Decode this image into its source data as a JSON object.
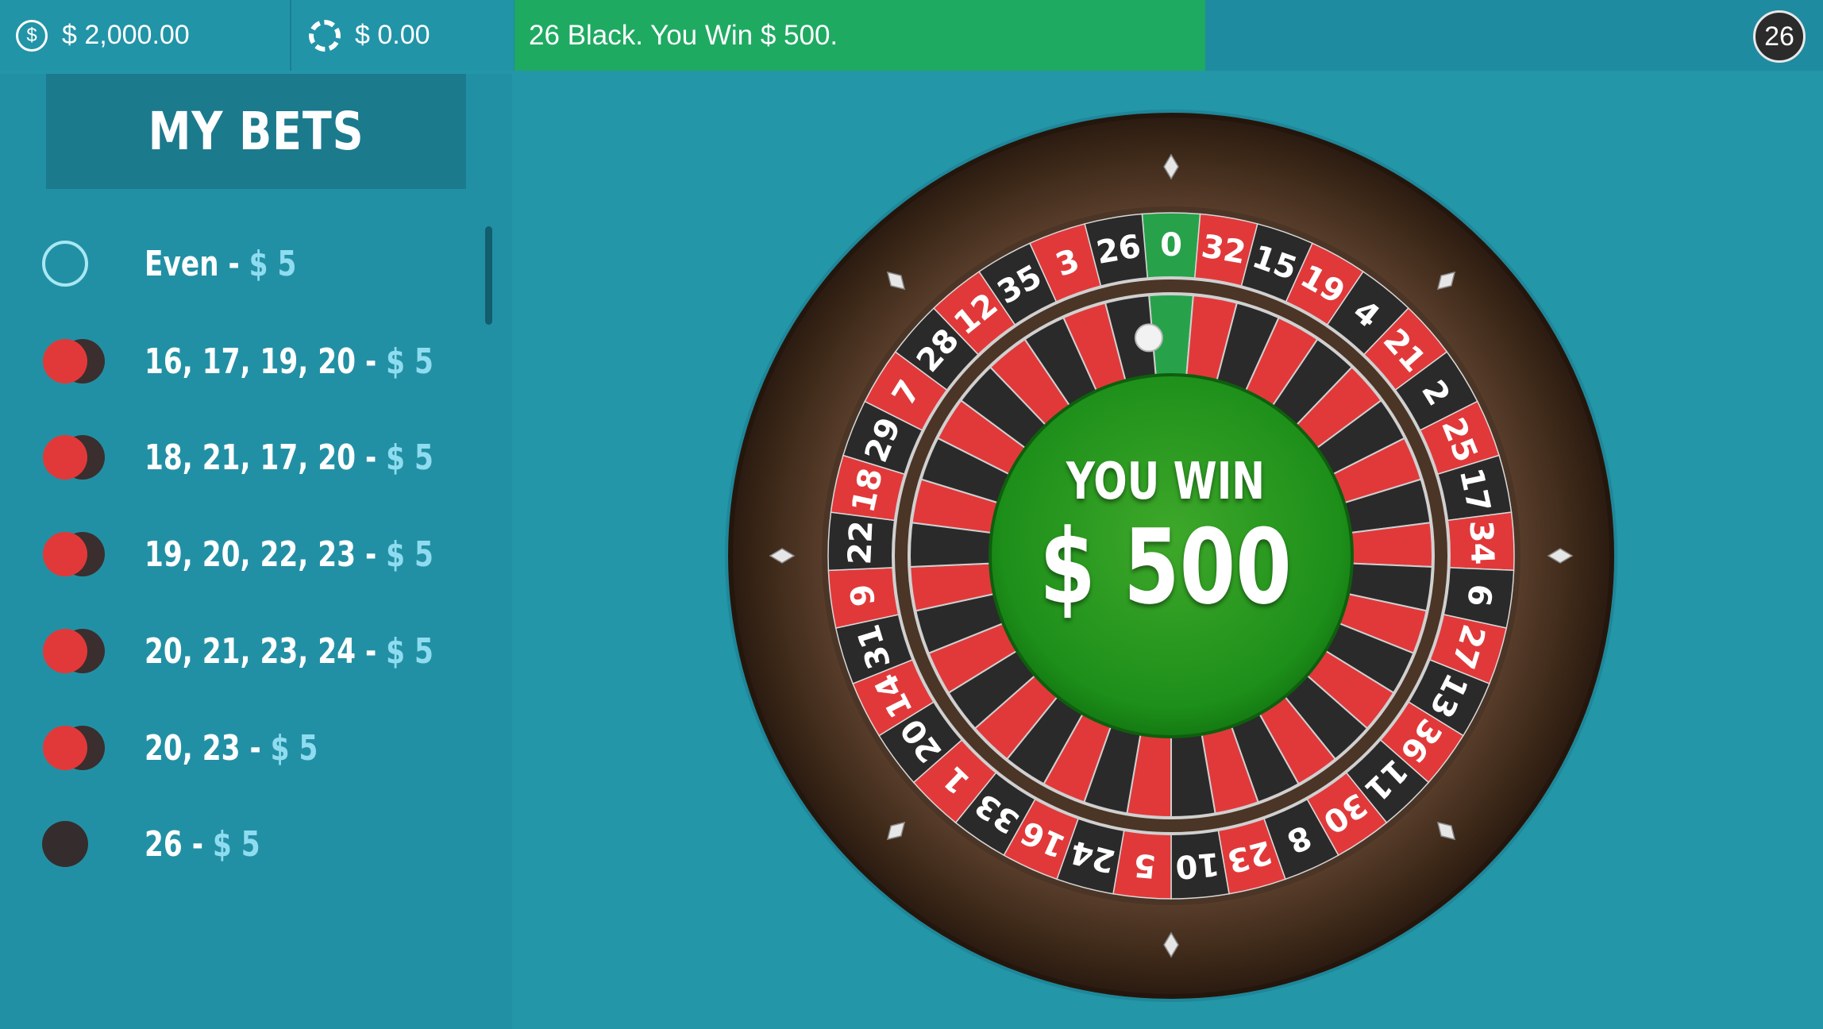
{
  "header": {
    "balance": "$ 2,000.00",
    "chips": "$ 0.00",
    "message": "26 Black. You Win $ 500.",
    "last_result": "26",
    "coin_icon_glyph": "$"
  },
  "sidebar": {
    "title": "MY BETS",
    "bets": [
      {
        "label": "Even",
        "separator": " - ",
        "amount": "$ 5",
        "chip": "outline"
      },
      {
        "label": "16, 17, 19, 20",
        "separator": " - ",
        "amount": "$ 5",
        "chip": "red-dark"
      },
      {
        "label": "18, 21, 17, 20",
        "separator": " - ",
        "amount": "$ 5",
        "chip": "red-dark"
      },
      {
        "label": "19, 20, 22, 23",
        "separator": " - ",
        "amount": "$ 5",
        "chip": "red-dark"
      },
      {
        "label": "20, 21, 23, 24",
        "separator": " - ",
        "amount": "$ 5",
        "chip": "red-dark"
      },
      {
        "label": "20, 23",
        "separator": " - ",
        "amount": "$ 5",
        "chip": "red-dark"
      },
      {
        "label": "26",
        "separator": " - ",
        "amount": "$ 5",
        "chip": "dark"
      }
    ]
  },
  "wheel": {
    "numbers": [
      "0",
      "32",
      "15",
      "19",
      "4",
      "21",
      "2",
      "25",
      "17",
      "34",
      "6",
      "27",
      "13",
      "36",
      "11",
      "30",
      "8",
      "23",
      "10",
      "5",
      "24",
      "16",
      "33",
      "1",
      "20",
      "14",
      "31",
      "9",
      "22",
      "18",
      "29",
      "7",
      "28",
      "12",
      "35",
      "3",
      "26"
    ],
    "colors": {
      "red": "#e1393a",
      "black": "#2a2a2a",
      "green": "#27a24a"
    },
    "result": {
      "title": "YOU WIN",
      "amount": "$ 500"
    }
  },
  "colors": {
    "table": "#2396a8",
    "message_bg": "#1faa62",
    "amount_accent": "#8fdcf0"
  }
}
